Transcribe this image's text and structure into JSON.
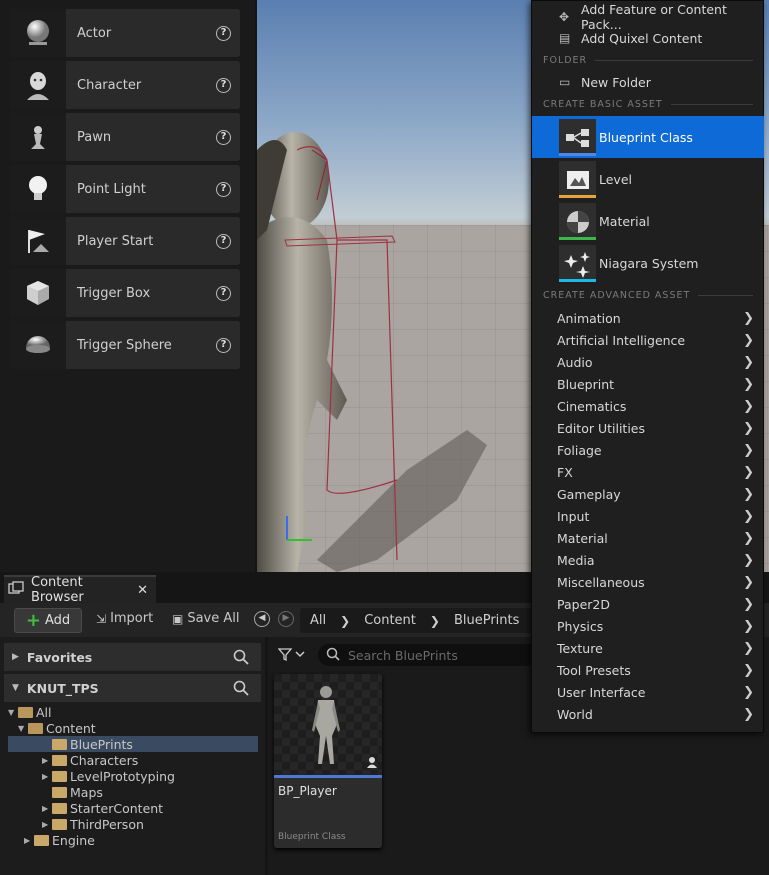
{
  "place_actors": {
    "items": [
      {
        "label": "Actor",
        "icon": "sphere-icon"
      },
      {
        "label": "Character",
        "icon": "character-icon"
      },
      {
        "label": "Pawn",
        "icon": "pawn-icon"
      },
      {
        "label": "Point Light",
        "icon": "light-bulb-icon"
      },
      {
        "label": "Player Start",
        "icon": "flag-icon"
      },
      {
        "label": "Trigger Box",
        "icon": "cube-icon"
      },
      {
        "label": "Trigger Sphere",
        "icon": "half-sphere-icon"
      }
    ],
    "help_glyph": "?"
  },
  "content_browser": {
    "tab_label": "Content Browser",
    "close_glyph": "✕",
    "toolbar": {
      "add_label": "Add",
      "import_label": "Import",
      "save_all_label": "Save All"
    },
    "breadcrumb": [
      "All",
      "Content",
      "BluePrints"
    ],
    "favorites_label": "Favorites",
    "project_label": "KNUT_TPS",
    "tree": [
      {
        "label": "All",
        "indent": 0,
        "arrow": "▼",
        "open": true
      },
      {
        "label": "Content",
        "indent": 1,
        "arrow": "▼",
        "open": true
      },
      {
        "label": "BluePrints",
        "indent": 2,
        "arrow": "",
        "open": false,
        "selected": true
      },
      {
        "label": "Characters",
        "indent": 2,
        "arrow": "▶",
        "open": false
      },
      {
        "label": "LevelPrototyping",
        "indent": 2,
        "arrow": "▶",
        "open": false
      },
      {
        "label": "Maps",
        "indent": 2,
        "arrow": "",
        "open": false
      },
      {
        "label": "StarterContent",
        "indent": 2,
        "arrow": "▶",
        "open": false
      },
      {
        "label": "ThirdPerson",
        "indent": 2,
        "arrow": "▶",
        "open": false
      },
      {
        "label": "Engine",
        "indent": 1,
        "arrow": "▶",
        "open": false
      }
    ],
    "search_placeholder": "Search BluePrints",
    "asset": {
      "name": "BP_Player",
      "class": "Blueprint Class"
    }
  },
  "context_menu": {
    "top_items": [
      {
        "label": "Add Feature or Content Pack...",
        "icon": "feature-pack-icon"
      },
      {
        "label": "Add Quixel Content",
        "icon": "quixel-icon"
      }
    ],
    "folder_section": "FOLDER",
    "new_folder": "New Folder",
    "basic_section": "CREATE BASIC ASSET",
    "basic_assets": [
      {
        "label": "Blueprint Class",
        "bar_color": "#4f86e8",
        "active": true
      },
      {
        "label": "Level",
        "bar_color": "#e6a43c",
        "active": false
      },
      {
        "label": "Material",
        "bar_color": "#3cb84a",
        "active": false
      },
      {
        "label": "Niagara System",
        "bar_color": "#1bb8e8",
        "active": false
      }
    ],
    "advanced_section": "CREATE ADVANCED ASSET",
    "advanced_assets": [
      "Animation",
      "Artificial Intelligence",
      "Audio",
      "Blueprint",
      "Cinematics",
      "Editor Utilities",
      "Foliage",
      "FX",
      "Gameplay",
      "Input",
      "Material",
      "Media",
      "Miscellaneous",
      "Paper2D",
      "Physics",
      "Texture",
      "Tool Presets",
      "User Interface",
      "World"
    ]
  }
}
